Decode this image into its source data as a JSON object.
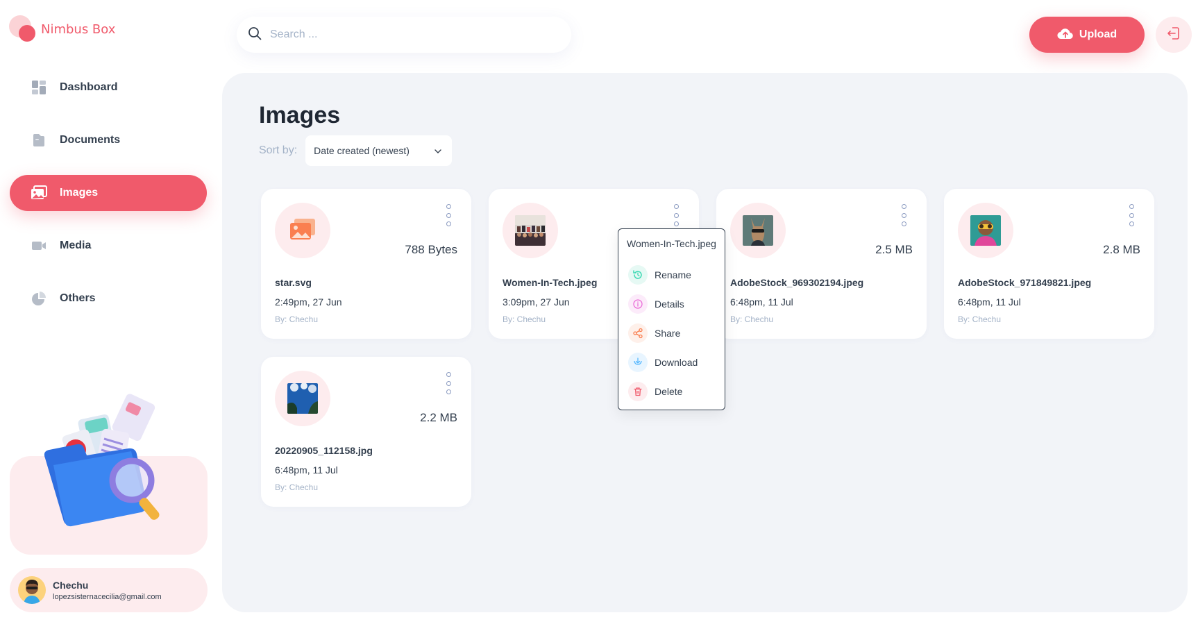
{
  "app": {
    "name": "Nimbus Box"
  },
  "sidebar": {
    "items": [
      {
        "label": "Dashboard",
        "icon": "dashboard-icon",
        "active": false
      },
      {
        "label": "Documents",
        "icon": "documents-icon",
        "active": false
      },
      {
        "label": "Images",
        "icon": "images-icon",
        "active": true
      },
      {
        "label": "Media",
        "icon": "media-icon",
        "active": false
      },
      {
        "label": "Others",
        "icon": "others-icon",
        "active": false
      }
    ]
  },
  "user": {
    "name": "Chechu",
    "email": "lopezsisternacecilia@gmail.com"
  },
  "header": {
    "search_placeholder": "Search ...",
    "upload_label": "Upload"
  },
  "page": {
    "title": "Images",
    "sort_label": "Sort by:",
    "sort_value": "Date created (newest)"
  },
  "files": [
    {
      "name": "star.svg",
      "size": "788 Bytes",
      "date": "2:49pm, 27 Jun",
      "by": "By: Chechu"
    },
    {
      "name": "Women-In-Tech.jpeg",
      "size": "",
      "date": "3:09pm, 27 Jun",
      "by": "By: Chechu"
    },
    {
      "name": "AdobeStock_969302194.jpeg",
      "size": "2.5 MB",
      "date": "6:48pm, 11 Jul",
      "by": "By: Chechu"
    },
    {
      "name": "AdobeStock_971849821.jpeg",
      "size": "2.8 MB",
      "date": "6:48pm, 11 Jul",
      "by": "By: Chechu"
    },
    {
      "name": "20220905_112158.jpg",
      "size": "2.2 MB",
      "date": "6:48pm, 11 Jul",
      "by": "By: Chechu"
    }
  ],
  "context_menu": {
    "title": "Women-In-Tech.jpeg",
    "items": [
      {
        "label": "Rename",
        "icon": "rename-icon",
        "color": "#3dd9b3"
      },
      {
        "label": "Details",
        "icon": "info-icon",
        "color": "#ea6ed8"
      },
      {
        "label": "Share",
        "icon": "share-icon",
        "color": "#fa7f50"
      },
      {
        "label": "Download",
        "icon": "download-icon",
        "color": "#56b8ff"
      },
      {
        "label": "Delete",
        "icon": "trash-icon",
        "color": "#f05a6b"
      }
    ]
  },
  "colors": {
    "brand": "#f05a6b",
    "brand_light": "#fdecee",
    "panel": "#f2f4f8",
    "text": "#333f4e",
    "muted": "#a3b2c7"
  }
}
